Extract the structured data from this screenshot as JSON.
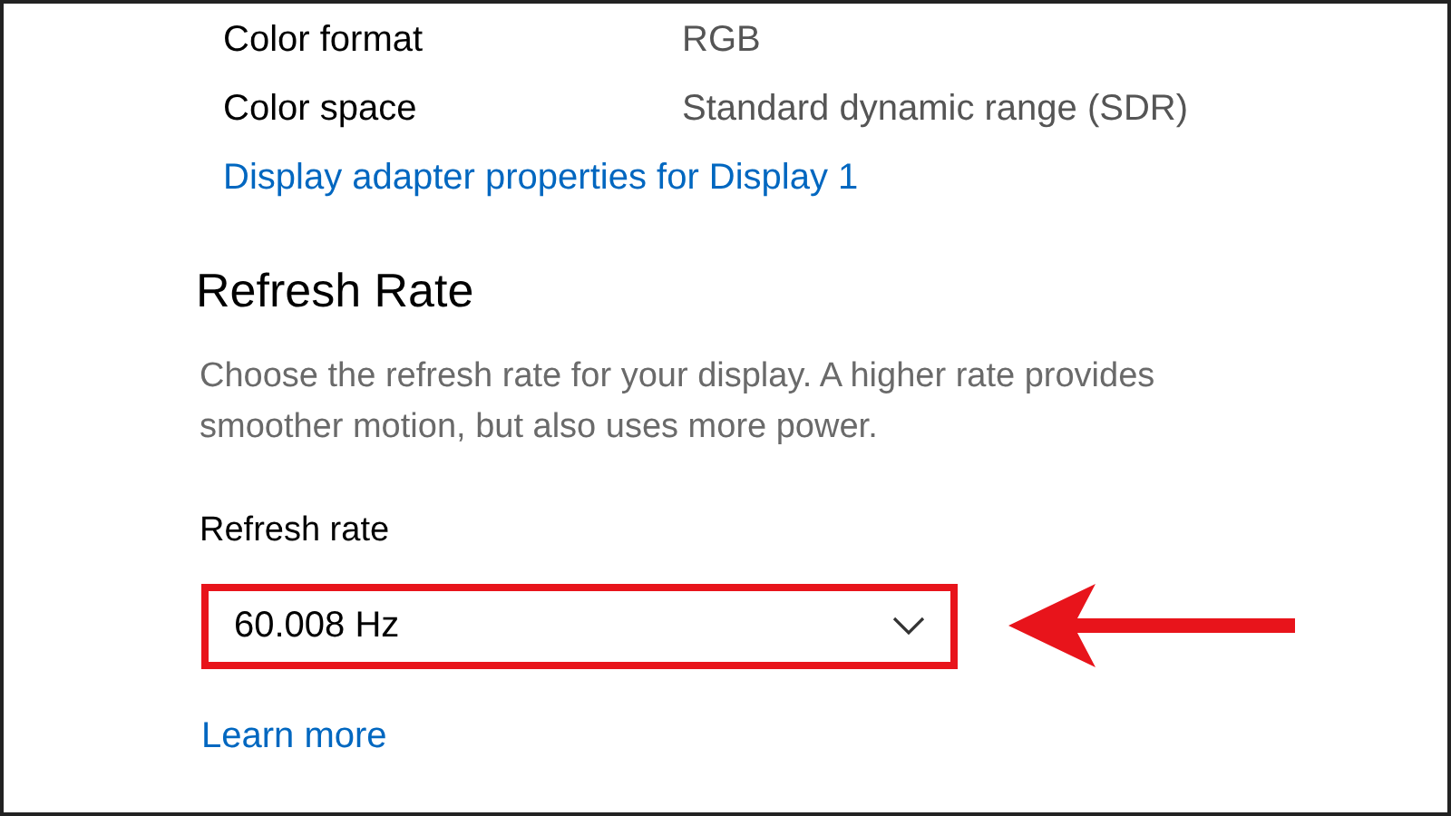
{
  "properties": [
    {
      "label": "Color format",
      "value": "RGB"
    },
    {
      "label": "Color space",
      "value": "Standard dynamic range (SDR)"
    }
  ],
  "adapter_link": "Display adapter properties for Display 1",
  "section": {
    "title": "Refresh Rate",
    "description": "Choose the refresh rate for your display. A higher rate provides smoother motion, but also uses more power."
  },
  "refresh_rate": {
    "label": "Refresh rate",
    "value": "60.008 Hz",
    "highlighted": true
  },
  "learn_more": "Learn more"
}
